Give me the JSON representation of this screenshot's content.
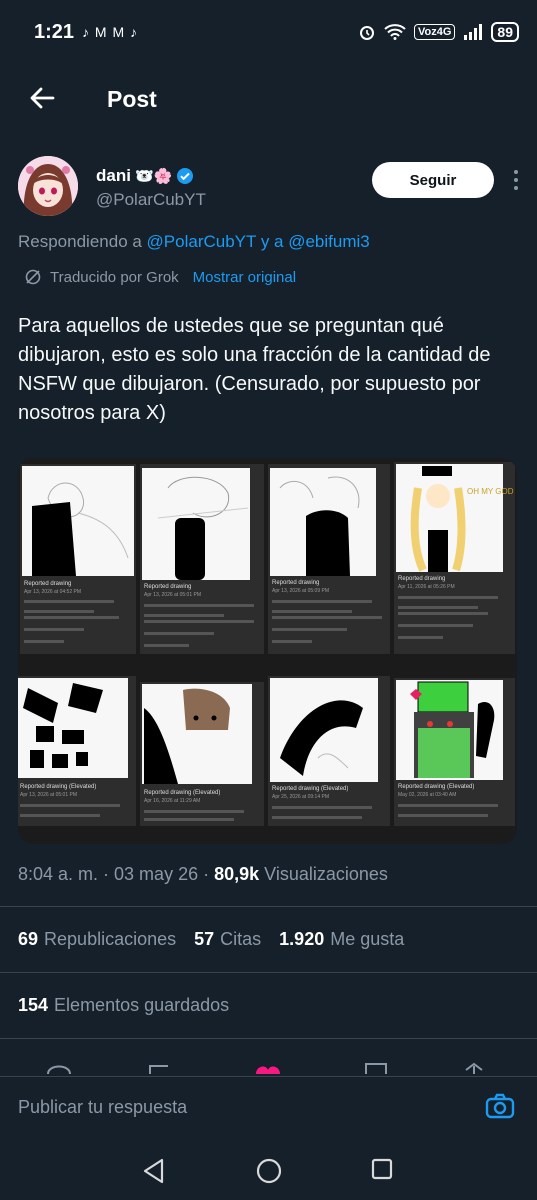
{
  "status_bar": {
    "time": "1:21",
    "app_icons": "♪ M M ♪",
    "network_badge": "Voz4G",
    "battery": "89"
  },
  "topbar": {
    "title": "Post"
  },
  "author": {
    "name": "dani",
    "name_emojis": "🐻‍❄️🌸",
    "handle": "@PolarCubYT",
    "follow_label": "Seguir"
  },
  "replying": {
    "prefix": "Respondiendo a ",
    "user1": "@PolarCubYT",
    "connector": " y a ",
    "user2": "@ebifumi3"
  },
  "translation": {
    "label": "Traducido por Grok",
    "show_original": "Mostrar original"
  },
  "post": {
    "text": "Para aquellos de ustedes que se preguntan qué dibujaron, esto es solo una fracción de la cantidad de NSFW que dibujaron. (Censurado, por supuesto por nosotros para X)"
  },
  "media": {
    "panels": [
      {
        "title": "Reported drawing",
        "date": "Apr 13, 2026 at 04:52 PM"
      },
      {
        "title": "Reported drawing",
        "date": "Apr 13, 2026 at 05:01 PM"
      },
      {
        "title": "Reported drawing",
        "date": "Apr 13, 2026 at 05:09 PM"
      },
      {
        "title": "Reported drawing",
        "date": "Apr 11, 2026 at 05:26 PM"
      },
      {
        "title": "Reported drawing (Elevated)",
        "date": "Apr 13, 2026 at 05:01 PM"
      },
      {
        "title": "Reported drawing (Elevated)",
        "date": "Apr 16, 2026 at 11:29 AM"
      },
      {
        "title": "Reported drawing (Elevated)",
        "date": "Apr 25, 2026 at 09:14 PM"
      },
      {
        "title": "Reported drawing (Elevated)",
        "date": "May 02, 2026 at 03:40 AM"
      }
    ],
    "drawing_text": "OH MY GOD"
  },
  "meta": {
    "time_date": "8:04 a. m. · 03 may 26 · ",
    "views_count": "80,9k",
    "views_label": " Visualizaciones"
  },
  "stats": {
    "reposts_count": "69",
    "reposts_label": "Republicaciones",
    "quotes_count": "57",
    "quotes_label": "Citas",
    "likes_count": "1.920",
    "likes_label": "Me gusta",
    "bookmarks_count": "154",
    "bookmarks_label": "Elementos guardados"
  },
  "reply_bar": {
    "placeholder": "Publicar tu respuesta"
  },
  "colors": {
    "background": "#15202b",
    "accent": "#1d9bf0",
    "muted": "#8b98a5",
    "divider": "#38444d"
  }
}
